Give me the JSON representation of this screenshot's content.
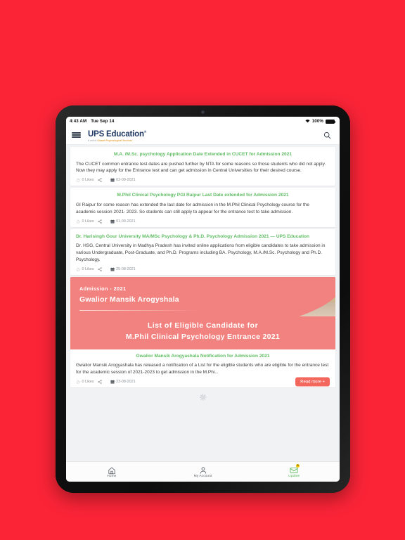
{
  "background_color": "#fb2437",
  "status_bar": {
    "time": "4:43 AM",
    "date": "Tue Sep 14",
    "battery": "100%",
    "wifi_icon": "wifi-icon",
    "battery_icon": "battery-full-icon"
  },
  "header": {
    "menu_icon": "hamburger-menu-icon",
    "brand_name": "UPS Education",
    "brand_registered": "®",
    "brand_sub_prefix": "A unit of ",
    "brand_sub_highlight": "Utsaah Psychological Services",
    "search_icon": "search-icon"
  },
  "feed": {
    "posts": [
      {
        "title": "M.A. /M.Sc. psychology Application Date Extended in CUCET for Admission 2021",
        "title_align": "center",
        "body": "The CUCET common entrance test dates are pushed further by NTA for some reasons so those students who did not apply. Now they may apply for the Entrance test and can get admission in Central Universities for their desired course.",
        "likes": "0 Likes",
        "date": "02-09-2021",
        "like_icon": "thumbs-up-icon",
        "share_icon": "share-icon",
        "date_icon": "calendar-icon",
        "read_more": null,
        "banner": null
      },
      {
        "title": "M.Phil Clinical Psychology PGI Raipur Last Date extended for Admission 2021",
        "title_align": "center",
        "body": "GI Raipur for some reason has extended the last date for admission in the M.Phil Clinical Psychology course for the academic session 2021- 2023. So students can still apply to appear for the entrance test to take admission.",
        "likes": "0 Likes",
        "date": "01-09-2021",
        "like_icon": "thumbs-up-icon",
        "share_icon": "share-icon",
        "date_icon": "calendar-icon",
        "read_more": null,
        "banner": null
      },
      {
        "title": "Dr. Harisingh Gour University MA/MSc Psychology & Ph.D. Psychology Admission 2021 — UPS Education",
        "title_align": "left",
        "body": "Dr. HSG, Central University in Madhya Pradesh has invited online applications from eligible candidates to take admission in various Undergraduate, Post-Graduate, and Ph.D. Programs including BA. Psychology, M.A./M.Sc. Psychology and Ph.D. Psychology.",
        "likes": "0 Likes",
        "date": "25-08-2021",
        "like_icon": "thumbs-up-icon",
        "share_icon": "share-icon",
        "date_icon": "calendar-icon",
        "read_more": null,
        "banner": null
      },
      {
        "title": "Gwalior Mansik Arogyashala Notification for Admission 2021",
        "title_align": "center",
        "body": "Gwalior Mansik Arogyashala has released a notification of a List for the eligible students who are eligible for the entrance test for the academic session of 2021-2023 to get admission in the M.Phi...",
        "likes": "0 Likes",
        "date": "23-08-2021",
        "like_icon": "thumbs-up-icon",
        "share_icon": "share-icon",
        "date_icon": "calendar-icon",
        "read_more": "Read more +",
        "banner": {
          "admission_label": "Admission - 2021",
          "org_name": "Gwalior Mansik Arogyshala",
          "line1": "List of Eligible Candidate for",
          "line2": "M.Phil Clinical Psychology Entrance 2021",
          "bg_color": "#f2827f"
        }
      }
    ],
    "loading_icon": "loading-spinner-icon"
  },
  "bottom_nav": {
    "items": [
      {
        "label": "Home",
        "icon": "home-icon",
        "active": false,
        "badge": null
      },
      {
        "label": "My Account",
        "icon": "user-icon",
        "active": false,
        "badge": null
      },
      {
        "label": "Update",
        "icon": "envelope-icon",
        "active": true,
        "badge": "0"
      }
    ],
    "active_color": "#53b857"
  }
}
